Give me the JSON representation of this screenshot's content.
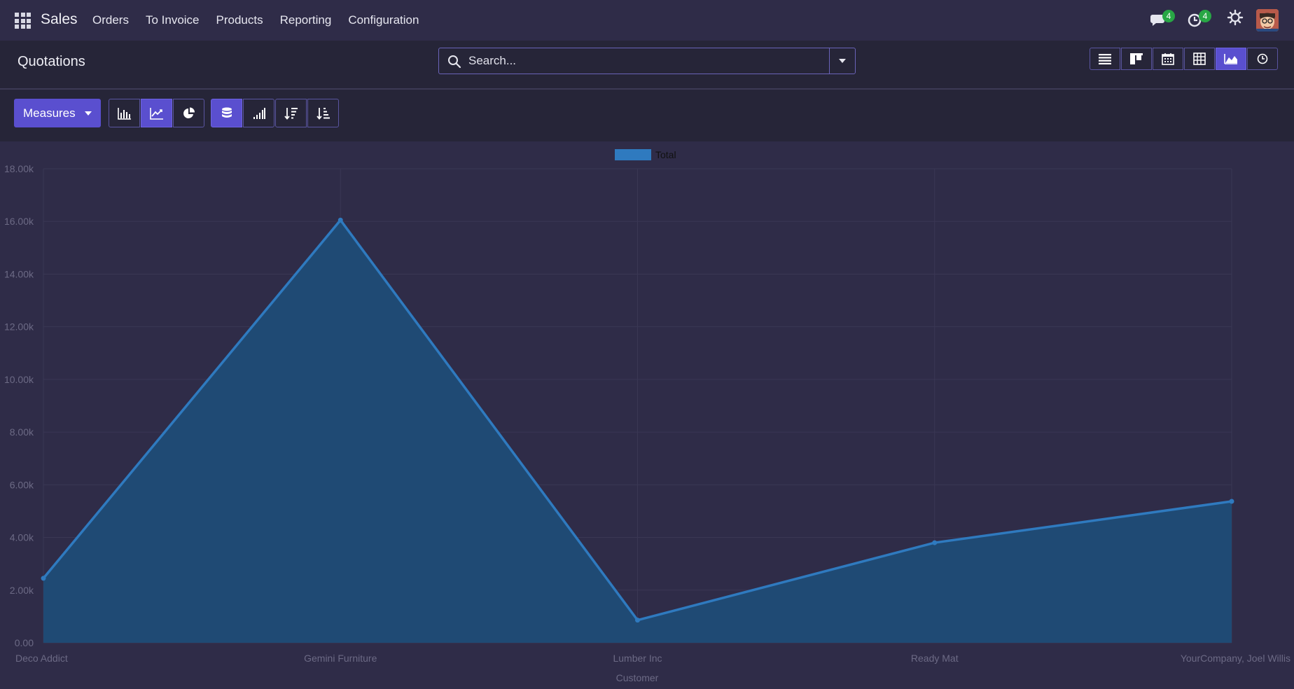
{
  "navbar": {
    "brand": "Sales",
    "menu": [
      "Orders",
      "To Invoice",
      "Products",
      "Reporting",
      "Configuration"
    ],
    "messages_badge": "4",
    "activities_badge": "4",
    "icons": [
      "apps-grid-icon",
      "chat-icon",
      "clock-icon",
      "debug-icon",
      "avatar"
    ]
  },
  "control_panel": {
    "title": "Quotations",
    "search_placeholder": "Search...",
    "views": [
      "list",
      "kanban",
      "calendar",
      "pivot",
      "graph",
      "activity"
    ],
    "active_view": "graph"
  },
  "toolbar": {
    "measures_label": "Measures",
    "chart_types": [
      "bar",
      "line",
      "pie"
    ],
    "active_chart_type": "line",
    "stacked_active": true
  },
  "colors": {
    "series": "#2f7abf",
    "fill": "#1f4a74",
    "accent": "#5a4fcf"
  },
  "chart_data": {
    "type": "area",
    "title": "",
    "xlabel": "Customer",
    "ylabel": "",
    "categories": [
      "Deco Addict",
      "Gemini Furniture",
      "Lumber Inc",
      "Ready Mat",
      "YourCompany, Joel Willis"
    ],
    "series": [
      {
        "name": "Total",
        "values": [
          2450,
          16050,
          860,
          3800,
          5370
        ]
      }
    ],
    "ylim": [
      0,
      18000
    ],
    "yticks": [
      "0.00",
      "2.00k",
      "4.00k",
      "6.00k",
      "8.00k",
      "10.00k",
      "12.00k",
      "14.00k",
      "16.00k",
      "18.00k"
    ],
    "grid": true,
    "legend": "top-center"
  }
}
